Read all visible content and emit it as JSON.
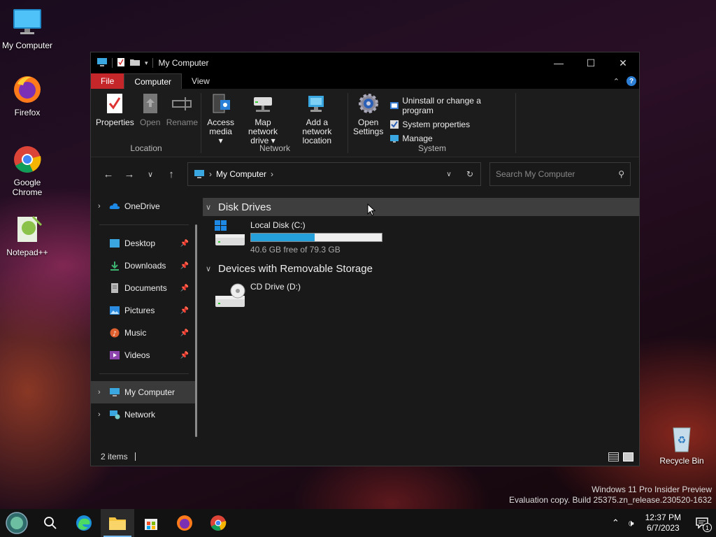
{
  "desktop": {
    "icons": [
      {
        "label": "My Computer"
      },
      {
        "label": "Firefox"
      },
      {
        "label": "Google Chrome"
      },
      {
        "label": "Notepad++"
      },
      {
        "label": "Recycle Bin"
      }
    ]
  },
  "window": {
    "title": "My Computer",
    "tabs": [
      "File",
      "Computer",
      "View"
    ],
    "ribbon": {
      "location": {
        "name": "Location",
        "buttons": [
          "Properties",
          "Open",
          "Rename"
        ]
      },
      "network": {
        "name": "Network",
        "access_media": [
          "Access",
          "media"
        ],
        "map_drive": [
          "Map network",
          "drive"
        ],
        "add_location": [
          "Add a network",
          "location"
        ]
      },
      "system": {
        "name": "System",
        "open_settings": [
          "Open",
          "Settings"
        ],
        "small": [
          "Uninstall or change a program",
          "System properties",
          "Manage"
        ]
      }
    },
    "address": {
      "path": "My Computer"
    },
    "search": {
      "placeholder": "Search My Computer"
    },
    "nav": {
      "onedrive": "OneDrive",
      "quick": [
        "Desktop",
        "Downloads",
        "Documents",
        "Pictures",
        "Music",
        "Videos"
      ],
      "my_computer": "My Computer",
      "network": "Network"
    },
    "groups": {
      "disk_drives": "Disk Drives",
      "removable": "Devices with Removable Storage"
    },
    "drives": {
      "c": {
        "name": "Local Disk (C:)",
        "free": "40.6 GB free of 79.3 GB",
        "used_fraction": 0.488
      },
      "d": {
        "name": "CD Drive (D:)"
      }
    },
    "status": {
      "items": "2 items"
    }
  },
  "watermark": {
    "line1": "Windows 11 Pro Insider Preview",
    "line2": "Evaluation copy. Build 25375.zn_release.230520-1632"
  },
  "taskbar": {
    "time": "12:37 PM",
    "date": "6/7/2023",
    "notifications": "1"
  },
  "colors": {
    "accent": "#26a0da",
    "file_tab": "#c4262a",
    "highlight": "#3a3a3a"
  }
}
